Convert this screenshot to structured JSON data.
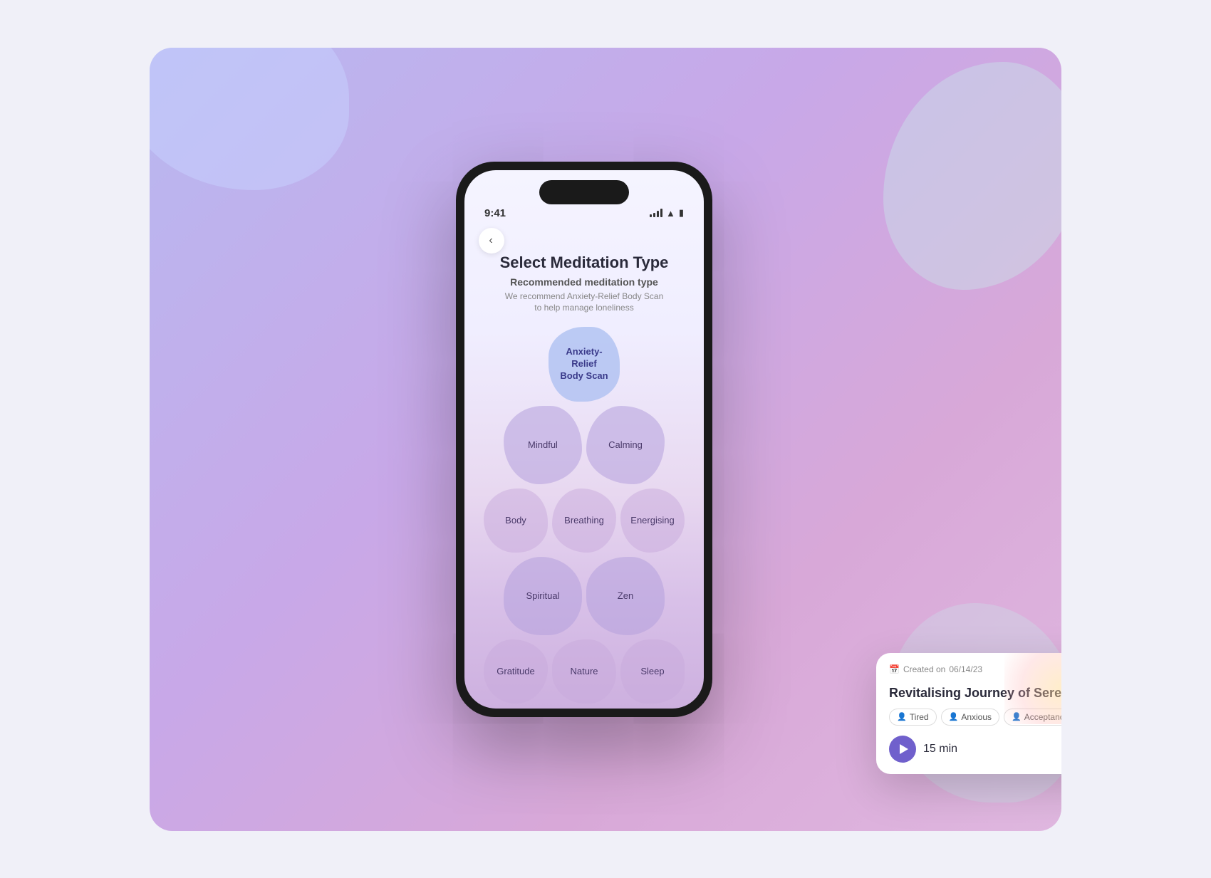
{
  "background": {
    "gradient": "linear-gradient(135deg, #b8b8f0, #c8a8e8, #d8a8d8)"
  },
  "phone": {
    "status_bar": {
      "time": "9:41",
      "signal": "●●●",
      "wifi": "wifi",
      "battery": "battery"
    },
    "back_button_label": "‹",
    "screen_title": "Select Meditation Type",
    "recommended_label": "Recommended meditation type",
    "recommended_desc": "We recommend Anxiety-Relief Body Scan\nto help manage loneliness",
    "meditation_types": [
      {
        "id": "anxiety-relief",
        "label": "Anxiety-\nRelief\nBody Scan",
        "size": "flower",
        "selected": true,
        "row": 1
      },
      {
        "id": "mindful",
        "label": "Mindful",
        "size": "large",
        "selected": false,
        "row": 2
      },
      {
        "id": "calming",
        "label": "Calming",
        "size": "large",
        "selected": false,
        "row": 2
      },
      {
        "id": "body",
        "label": "Body",
        "size": "medium",
        "selected": false,
        "row": 3
      },
      {
        "id": "breathing",
        "label": "Breathing",
        "size": "medium",
        "selected": false,
        "row": 3
      },
      {
        "id": "energising",
        "label": "Energising",
        "size": "medium",
        "selected": false,
        "row": 3
      },
      {
        "id": "spiritual",
        "label": "Spiritual",
        "size": "large",
        "selected": false,
        "row": 4
      },
      {
        "id": "zen",
        "label": "Zen",
        "size": "large",
        "selected": false,
        "row": 4
      },
      {
        "id": "gratitude",
        "label": "Gratitude",
        "size": "medium",
        "selected": false,
        "row": 5
      },
      {
        "id": "nature",
        "label": "Nature",
        "size": "medium",
        "selected": false,
        "row": 5
      },
      {
        "id": "sleep",
        "label": "Sleep",
        "size": "medium",
        "selected": false,
        "row": 5
      }
    ]
  },
  "card": {
    "created_label": "Created on",
    "created_date": "06/14/23",
    "title": "Revitalising Journey of Serenity",
    "close_label": "×",
    "tags": [
      {
        "label": "Tired",
        "icon": "👤"
      },
      {
        "label": "Anxious",
        "icon": "👤"
      },
      {
        "label": "Acceptance",
        "icon": "👤"
      }
    ],
    "duration": "15 min",
    "play_label": "▶",
    "doc_icon": "📄"
  }
}
